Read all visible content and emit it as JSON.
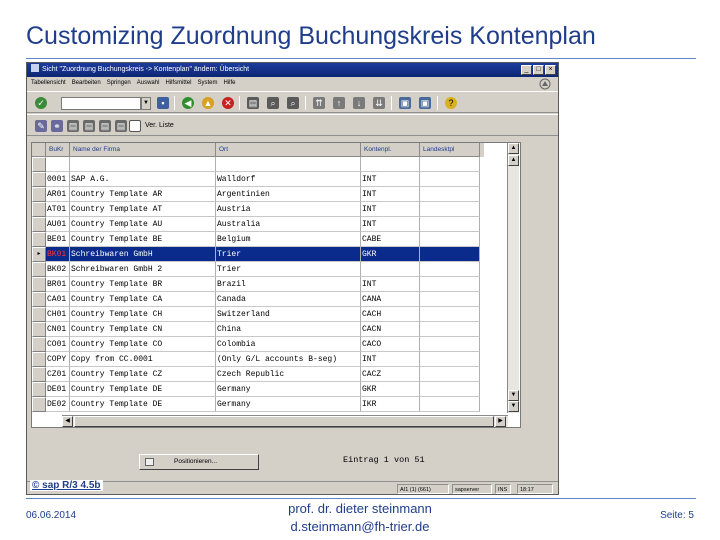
{
  "slide": {
    "title": "Customizing Zuordnung Buchungskreis Kontenplan",
    "copyright": "© sap R/3 4.5b",
    "footer": {
      "date": "06.06.2014",
      "author_line1": "prof. dr. dieter steinmann",
      "author_line2": "d.steinmann@fh-trier.de",
      "page": "Seite: 5"
    }
  },
  "window": {
    "title": "Sicht \"Zuordnung Buchungskreis -> Kontenplan\" ändern: Übersicht",
    "buttons": {
      "minimize": "_",
      "maximize": "□",
      "close": "×"
    }
  },
  "menu": [
    {
      "label": "Tabellensicht",
      "underline": "T"
    },
    {
      "label": "Bearbeiten",
      "underline": "B"
    },
    {
      "label": "Springen",
      "underline": "S"
    },
    {
      "label": "Auswahl",
      "underline": "A"
    },
    {
      "label": "Hilfsmittel",
      "underline": "H"
    },
    {
      "label": "System",
      "underline": "y"
    },
    {
      "label": "Hilfe",
      "underline": "H"
    }
  ],
  "toolbar2": {
    "ver_liste": "Ver. Liste"
  },
  "table": {
    "headers": {
      "bukrs": "BuKr",
      "name": "Name der Firma",
      "ort": "Ort",
      "kontenpl": "Kontenpl.",
      "landesktpl": "Landesktpl"
    },
    "rows": [
      {
        "bukrs": "",
        "name": "",
        "ort": "",
        "kontenpl": "",
        "landesktpl": "",
        "selected": false
      },
      {
        "bukrs": "0001",
        "name": "SAP A.G.",
        "ort": "Walldorf",
        "kontenpl": "INT",
        "landesktpl": "",
        "selected": false
      },
      {
        "bukrs": "AR01",
        "name": "Country Template AR",
        "ort": "Argentinien",
        "kontenpl": "INT",
        "landesktpl": "",
        "selected": false
      },
      {
        "bukrs": "AT01",
        "name": "Country Template AT",
        "ort": "Austria",
        "kontenpl": "INT",
        "landesktpl": "",
        "selected": false
      },
      {
        "bukrs": "AU01",
        "name": "Country Template AU",
        "ort": "Australia",
        "kontenpl": "INT",
        "landesktpl": "",
        "selected": false
      },
      {
        "bukrs": "BE01",
        "name": "Country Template BE",
        "ort": "Belgium",
        "kontenpl": "CABE",
        "landesktpl": "",
        "selected": false
      },
      {
        "bukrs": "BK01",
        "name": "Schreibwaren GmbH",
        "ort": "Trier",
        "kontenpl": "GKR",
        "landesktpl": "",
        "selected": true
      },
      {
        "bukrs": "BK02",
        "name": "Schreibwaren GmbH 2",
        "ort": "Trier",
        "kontenpl": "",
        "landesktpl": "",
        "selected": false
      },
      {
        "bukrs": "BR01",
        "name": "Country Template BR",
        "ort": "Brazil",
        "kontenpl": "INT",
        "landesktpl": "",
        "selected": false
      },
      {
        "bukrs": "CA01",
        "name": "Country Template CA",
        "ort": "Canada",
        "kontenpl": "CANA",
        "landesktpl": "",
        "selected": false
      },
      {
        "bukrs": "CH01",
        "name": "Country Template CH",
        "ort": "Switzerland",
        "kontenpl": "CACH",
        "landesktpl": "",
        "selected": false
      },
      {
        "bukrs": "CN01",
        "name": "Country Template CN",
        "ort": "China",
        "kontenpl": "CACN",
        "landesktpl": "",
        "selected": false
      },
      {
        "bukrs": "CO01",
        "name": "Country Template CO",
        "ort": "Colombia",
        "kontenpl": "CACO",
        "landesktpl": "",
        "selected": false
      },
      {
        "bukrs": "COPY",
        "name": "Copy from CC.0001",
        "ort": "(Only G/L accounts B-seg)",
        "kontenpl": "INT",
        "landesktpl": "",
        "selected": false
      },
      {
        "bukrs": "CZ01",
        "name": "Country Template CZ",
        "ort": "Czech Republic",
        "kontenpl": "CACZ",
        "landesktpl": "",
        "selected": false
      },
      {
        "bukrs": "DE01",
        "name": "Country Template DE",
        "ort": "Germany",
        "kontenpl": "GKR",
        "landesktpl": "",
        "selected": false
      },
      {
        "bukrs": "DE02",
        "name": "Country Template DE",
        "ort": "Germany",
        "kontenpl": "IKR",
        "landesktpl": "",
        "selected": false
      }
    ]
  },
  "positionieren": "Positionieren...",
  "entry_info": "Eintrag 1 von 51",
  "status": {
    "session": "AI1 (1) (661)",
    "server": "sapserver",
    "mode": "INS",
    "time": "18:17"
  },
  "colors": {
    "title_blue": "#1f3d8a",
    "selection_blue": "#0a2a8c",
    "key_red": "#ff3030",
    "sap_gray": "#d4d0c8"
  }
}
